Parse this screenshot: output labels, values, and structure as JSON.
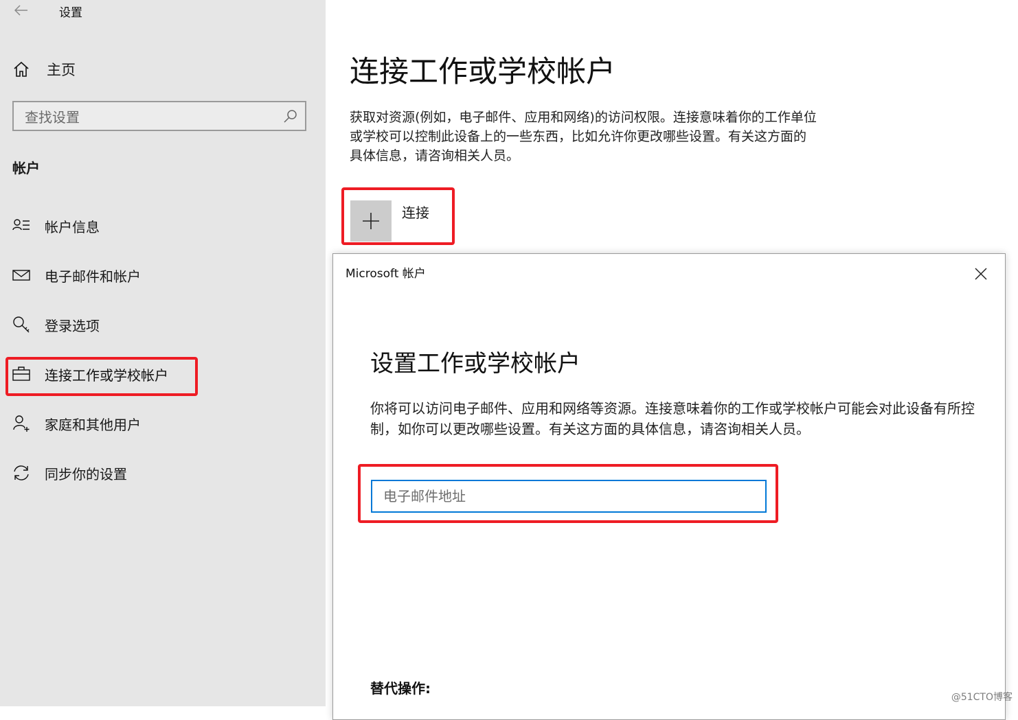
{
  "app": {
    "title": "设置"
  },
  "sidebar": {
    "home_label": "主页",
    "search_placeholder": "查找设置",
    "section_header": "帐户",
    "items": [
      {
        "label": "帐户信息",
        "icon": "account-info-icon"
      },
      {
        "label": "电子邮件和帐户",
        "icon": "mail-icon"
      },
      {
        "label": "登录选项",
        "icon": "key-icon"
      },
      {
        "label": "连接工作或学校帐户",
        "icon": "briefcase-icon",
        "active": true
      },
      {
        "label": "家庭和其他用户",
        "icon": "person-add-icon"
      },
      {
        "label": "同步你的设置",
        "icon": "sync-icon"
      }
    ]
  },
  "main": {
    "title": "连接工作或学校帐户",
    "description": "获取对资源(例如，电子邮件、应用和网络)的访问权限。连接意味着你的工作单位或学校可以控制此设备上的一些东西，比如允许你更改哪些设置。有关这方面的具体信息，请咨询相关人员。",
    "connect_label": "连接"
  },
  "dialog": {
    "title": "Microsoft 帐户",
    "heading": "设置工作或学校帐户",
    "description": "你将可以访问电子邮件、应用和网络等资源。连接意味着你的工作或学校帐户可能会对此设备有所控制，如你可以更改哪些设置。有关这方面的具体信息，请咨询相关人员。",
    "email_placeholder": "电子邮件地址",
    "email_value": "",
    "alt_label": "替代操作:"
  },
  "watermark": "@51CTO博客",
  "colors": {
    "sidebar_bg": "#e6e6e6",
    "highlight_red": "#ee1c24",
    "input_focus_blue": "#0078d7",
    "plus_tile": "#cccccc"
  }
}
